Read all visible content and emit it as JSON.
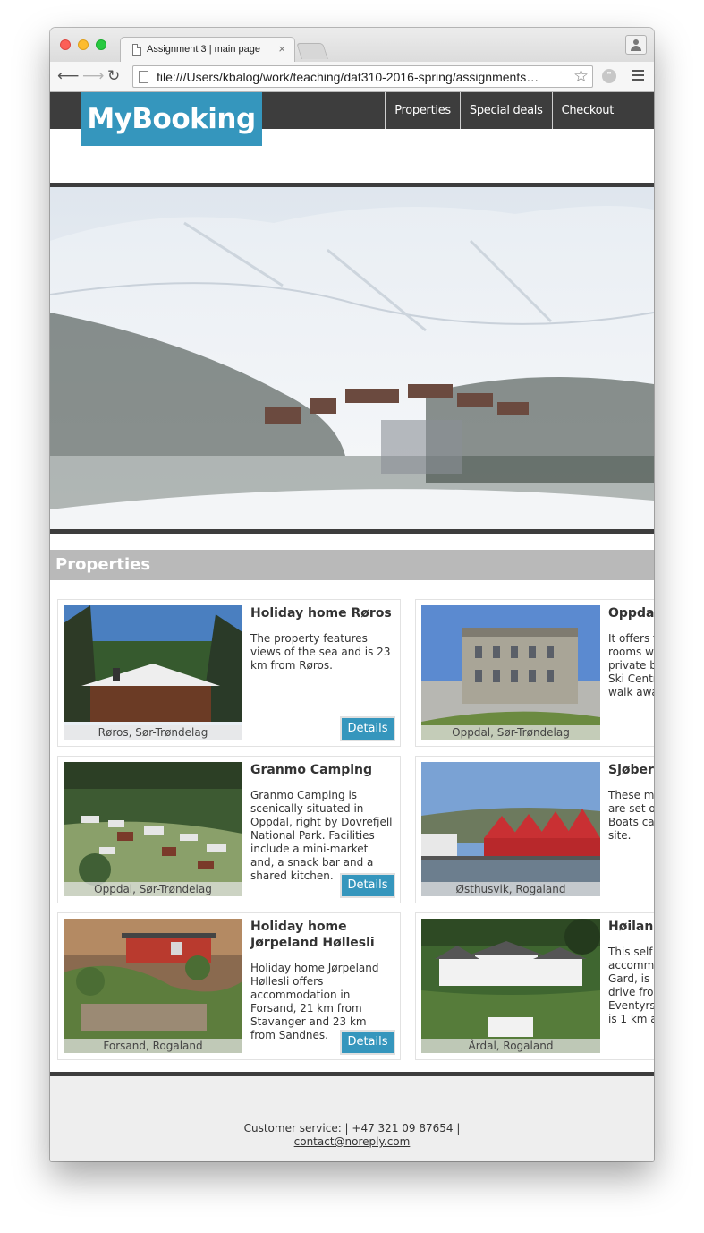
{
  "browser": {
    "tab_title": "Assignment 3 | main page",
    "url": "file:///Users/kbalog/work/teaching/dat310-2016-spring/assignments…"
  },
  "site": {
    "logo": "MyBooking",
    "nav": [
      "Properties",
      "Special deals",
      "Checkout"
    ],
    "section_title": "Properties",
    "details_label": "Details"
  },
  "properties": [
    {
      "name": "Holiday home Røros",
      "desc": "The property features views of the sea and is 23 km from Røros.",
      "location": "Røros, Sør-Trøndelag"
    },
    {
      "name": "Oppda",
      "desc": "It offers f rooms w private b Ski Centr walk awa",
      "location": "Oppdal, Sør-Trøndelag"
    },
    {
      "name": "Granmo Camping",
      "desc": "Granmo Camping is scenically situated in Oppdal, right by Dovrefjell National Park. Facilities include a mini-market and, a snack bar and a shared kitchen.",
      "location": "Oppdal, Sør-Trøndelag"
    },
    {
      "name": "Sjøberg",
      "desc": "These m are set o Boats ca site.",
      "location": "Østhusvik, Rogaland"
    },
    {
      "name": "Holiday home Jørpeland Høllesli",
      "desc": "Holiday home Jørpeland Høllesli offers accommodation in Forsand, 21 km from Stavanger and 23 km from Sandnes.",
      "location": "Forsand, Rogaland"
    },
    {
      "name": "Høiland",
      "desc": "This self accomm Gard, is l drive fro Eventyrs is 1 km a",
      "location": "Årdal, Rogaland"
    }
  ],
  "footer": {
    "service": "Customer service: | +47 321 09 87654 |",
    "email": "contact@noreply.com"
  },
  "colors": {
    "accent": "#3596bd",
    "header_bg": "#3d3d3d",
    "section_bar": "#b9b9b9"
  }
}
